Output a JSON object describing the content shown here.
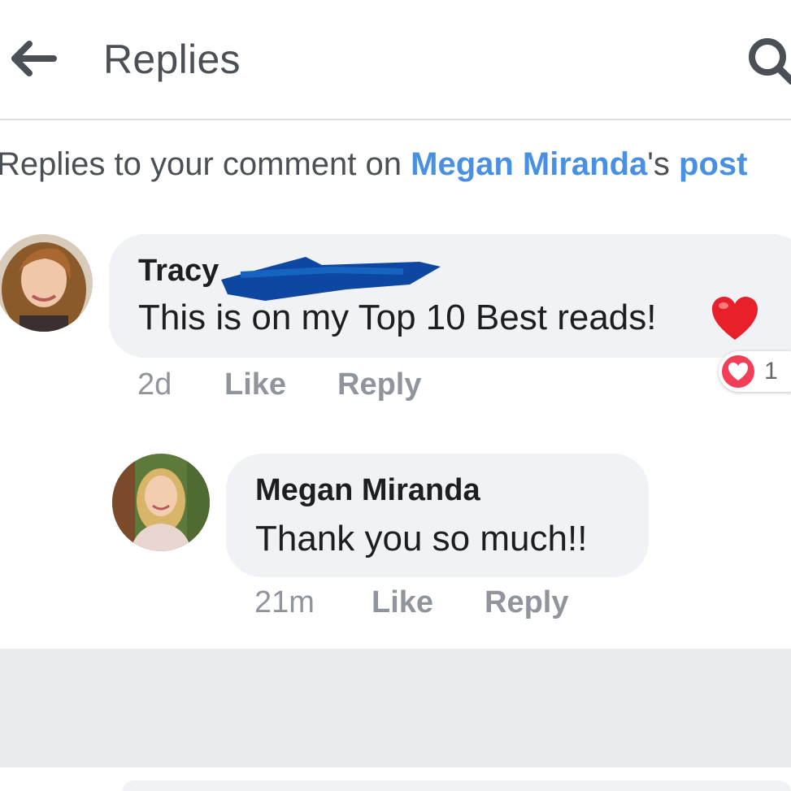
{
  "header": {
    "title": "Replies",
    "back_icon": "arrow-left-icon",
    "search_icon": "search-icon"
  },
  "context": {
    "prefix": "Replies to your comment on ",
    "author_link": "Megan Miranda",
    "possessive": "'s ",
    "post_link": "post"
  },
  "comments": [
    {
      "author": "Tracy",
      "text": "This is on my Top 10 Best reads!",
      "emoji": "red-heart-icon",
      "time": "2d",
      "like_label": "Like",
      "reply_label": "Reply",
      "reaction_count": "1",
      "reaction_icon": "love-reaction-icon"
    },
    {
      "author": "Megan Miranda",
      "text": "Thank you so much!!",
      "time": "21m",
      "like_label": "Like",
      "reply_label": "Reply"
    }
  ],
  "colors": {
    "link": "#4a90e2",
    "meta": "#90949c",
    "bubble": "#f0f2f5",
    "reaction": "#f33e58",
    "redaction": "#0d47a1"
  }
}
